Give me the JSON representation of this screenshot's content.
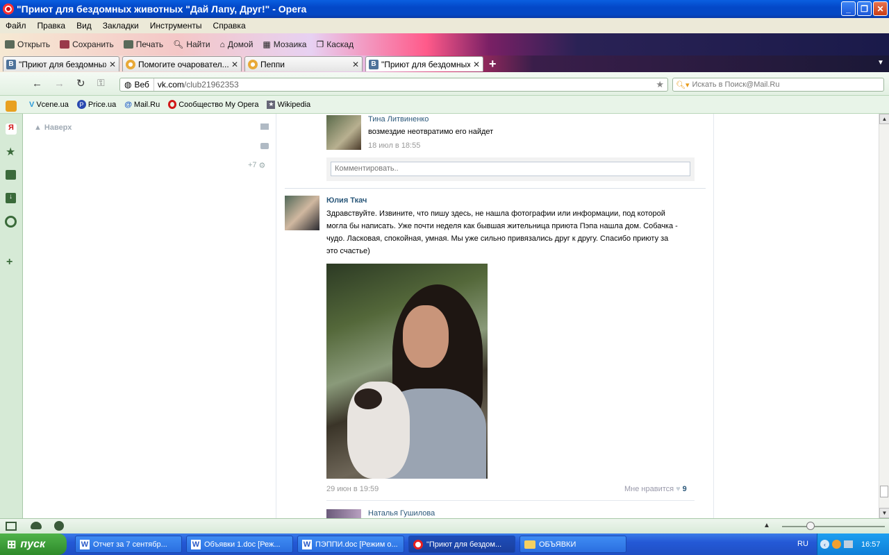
{
  "window": {
    "title": "\"Приют для бездомных животных \"Дай Лапу, Друг!\" - Opera"
  },
  "menu": [
    "Файл",
    "Правка",
    "Вид",
    "Закладки",
    "Инструменты",
    "Справка"
  ],
  "toolbar": [
    "Открыть",
    "Сохранить",
    "Печать",
    "Найти",
    "Домой",
    "Мозаика",
    "Каскад"
  ],
  "tabs": [
    {
      "label": "\"Приют для бездомных...",
      "icon": "vk-icon"
    },
    {
      "label": "Помогите очаровател...",
      "icon": "yandex-icon"
    },
    {
      "label": "Пеппи",
      "icon": "yandex-icon"
    },
    {
      "label": "\"Приют для бездомных...",
      "icon": "vk-icon"
    }
  ],
  "address": {
    "scheme_label": "Веб",
    "url_host": "vk.com",
    "url_path": "/club21962353"
  },
  "search": {
    "placeholder": "Искать в Поиск@Mail.Ru"
  },
  "bookmarks": [
    "Vcene.ua",
    "Price.ua",
    "Mail.Ru",
    "Сообщество My Opera",
    "Wikipedia"
  ],
  "page": {
    "back_to_top": "Наверх",
    "counter": "+7",
    "comment1": {
      "author": "Тина Литвиненко",
      "text": "возмездие неотвратимо его найдет",
      "date": "18 июл в 18:55"
    },
    "comment_placeholder": "Комментировать..",
    "post": {
      "author": "Юлия Ткач",
      "text_lines": [
        "Здравствуйте. Извините, что пишу здесь, не нашла фотографии или информации, под которой",
        "могла бы написать. Уже почти неделя как бывшая жительница приюта Пэпа нашла дом. Собачка -",
        "чудо. Ласковая, спокойная, умная. Мы уже сильно привязались друг к другу. Спасибо приюту за",
        "это счастье)"
      ],
      "date": "29 июн в 19:59",
      "like_label": "Мне нравится",
      "like_count": "9"
    },
    "comment2": {
      "author": "Наталья Гушилова"
    }
  },
  "taskbar": {
    "start": "пуск",
    "items": [
      "Отчет за 7 сентябр...",
      "Объявки 1.doc [Реж...",
      "ПЭППИ.doc [Режим о...",
      "\"Приют для бездом...",
      "ОБЪЯВКИ"
    ],
    "lang": "RU",
    "clock": "16:57"
  }
}
